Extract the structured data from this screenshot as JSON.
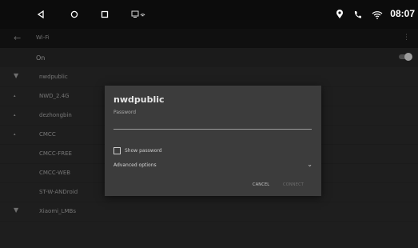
{
  "status_bar": {
    "time": "08:07",
    "nav_icons": [
      "back-triangle-icon",
      "home-circle-icon",
      "recents-square-icon",
      "screenshot-icon"
    ],
    "status_icons": [
      "location-pin-icon",
      "phone-icon",
      "wifi-icon"
    ]
  },
  "app_bar": {
    "title": "Wi-Fi",
    "back_icon": "arrow-back-icon",
    "more_icon": "more-vert-icon"
  },
  "wifi_switch": {
    "label": "On",
    "state": "on"
  },
  "networks": [
    {
      "ssid": "nwdpublic",
      "signal_icon": "wifi-signal-icon"
    },
    {
      "ssid": "NWD_2.4G",
      "signal_icon": "wifi-signal-icon"
    },
    {
      "ssid": "dezhongbin",
      "signal_icon": "wifi-signal-icon"
    },
    {
      "ssid": "CMCC",
      "signal_icon": "wifi-signal-icon"
    },
    {
      "ssid": "CMCC-FREE",
      "signal_icon": ""
    },
    {
      "ssid": "CMCC-WEB",
      "signal_icon": ""
    },
    {
      "ssid": "ST-W-ANDroid",
      "signal_icon": ""
    },
    {
      "ssid": "Xiaomi_LMBs",
      "signal_icon": "wifi-signal-icon"
    }
  ],
  "dialog": {
    "title": "nwdpublic",
    "password_label": "Password",
    "password_value": "",
    "show_password_label": "Show password",
    "show_password_checked": false,
    "advanced_label": "Advanced options",
    "cancel_label": "CANCEL",
    "connect_label": "CONNECT"
  },
  "colors": {
    "status_bar_bg": "#0c0c0c",
    "dialog_bg": "#3c3c3c",
    "list_bg": "#2a2a2a"
  }
}
